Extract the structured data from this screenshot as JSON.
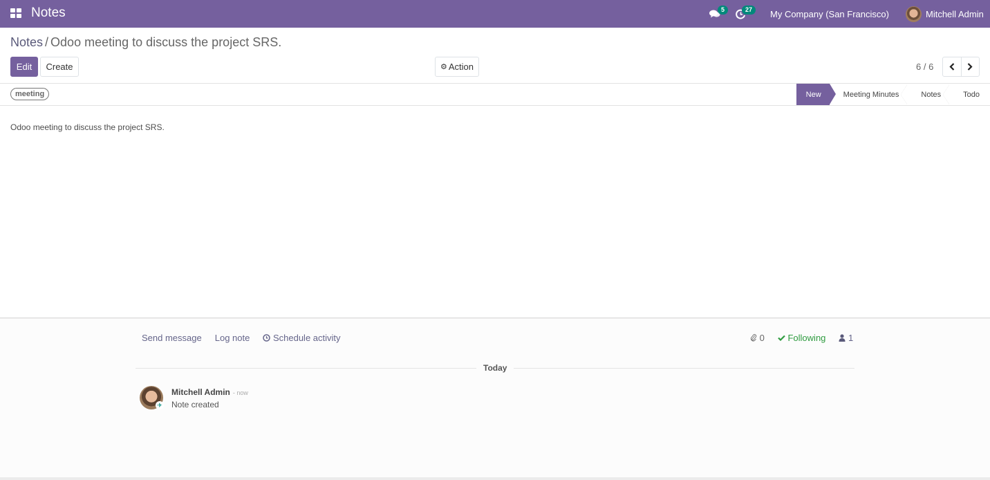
{
  "navbar": {
    "app_name": "Notes",
    "messages_count": "5",
    "activities_count": "27",
    "company": "My Company (San Francisco)",
    "user_name": "Mitchell Admin",
    "icons": {
      "apps": "apps-grid-icon",
      "messages": "comments-icon",
      "activities": "clock-icon"
    },
    "color": "#75609e"
  },
  "breadcrumb": {
    "parent": "Notes",
    "separator": "/",
    "current": "Odoo meeting to discuss the project SRS."
  },
  "toolbar": {
    "edit_label": "Edit",
    "create_label": "Create",
    "action_label": "Action",
    "action_icon": "⚙"
  },
  "pager": {
    "value": "6 / 6",
    "prev_icon": "‹",
    "next_icon": "›"
  },
  "record": {
    "tags": [
      "meeting"
    ],
    "stages": [
      {
        "label": "New",
        "active": true
      },
      {
        "label": "Meeting Minutes",
        "active": false
      },
      {
        "label": "Notes",
        "active": false
      },
      {
        "label": "Todo",
        "active": false
      }
    ],
    "memo": "Odoo meeting to discuss the project SRS."
  },
  "chatter": {
    "send_message": "Send message",
    "log_note": "Log note",
    "schedule_activity": "Schedule activity",
    "attachments_count": "0",
    "following_label": "Following",
    "followers_count": "1",
    "date_separator": "Today",
    "messages": [
      {
        "author": "Mitchell Admin",
        "date": "- now",
        "body": "Note created"
      }
    ],
    "colors": {
      "following": "#2e9b3f",
      "badge": "#00897b"
    }
  }
}
